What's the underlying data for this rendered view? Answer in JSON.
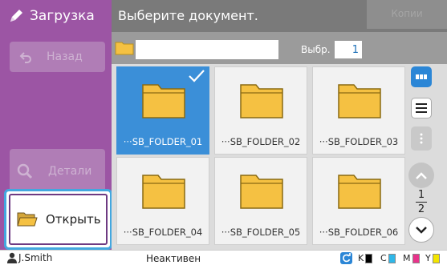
{
  "sidebar": {
    "title": "Загрузка",
    "icon": "scan-pen-icon",
    "back_label": "Назад",
    "details_label": "Детали",
    "open_label": "Открыть"
  },
  "header": {
    "title": "Выберите документ.",
    "copies_label": "Копии"
  },
  "path_bar": {
    "path_value": "",
    "select_label": "Выбр.",
    "select_count": "1"
  },
  "files": [
    {
      "name": "···SB_FOLDER_01",
      "selected": true
    },
    {
      "name": "···SB_FOLDER_02",
      "selected": false
    },
    {
      "name": "···SB_FOLDER_03",
      "selected": false
    },
    {
      "name": "···SB_FOLDER_04",
      "selected": false
    },
    {
      "name": "···SB_FOLDER_05",
      "selected": false
    },
    {
      "name": "···SB_FOLDER_06",
      "selected": false
    }
  ],
  "pagination": {
    "current": "1",
    "total": "2"
  },
  "status": {
    "user": "J.Smith",
    "state": "Неактивен",
    "inks": [
      {
        "label": "K",
        "color": "#000000"
      },
      {
        "label": "C",
        "color": "#2FB7E8"
      },
      {
        "label": "M",
        "color": "#E8338B"
      },
      {
        "label": "Y",
        "color": "#F3E500"
      }
    ]
  },
  "colors": {
    "accent": "#9C55A4",
    "selected": "#3B8FD8",
    "folder": "#F5C142"
  }
}
